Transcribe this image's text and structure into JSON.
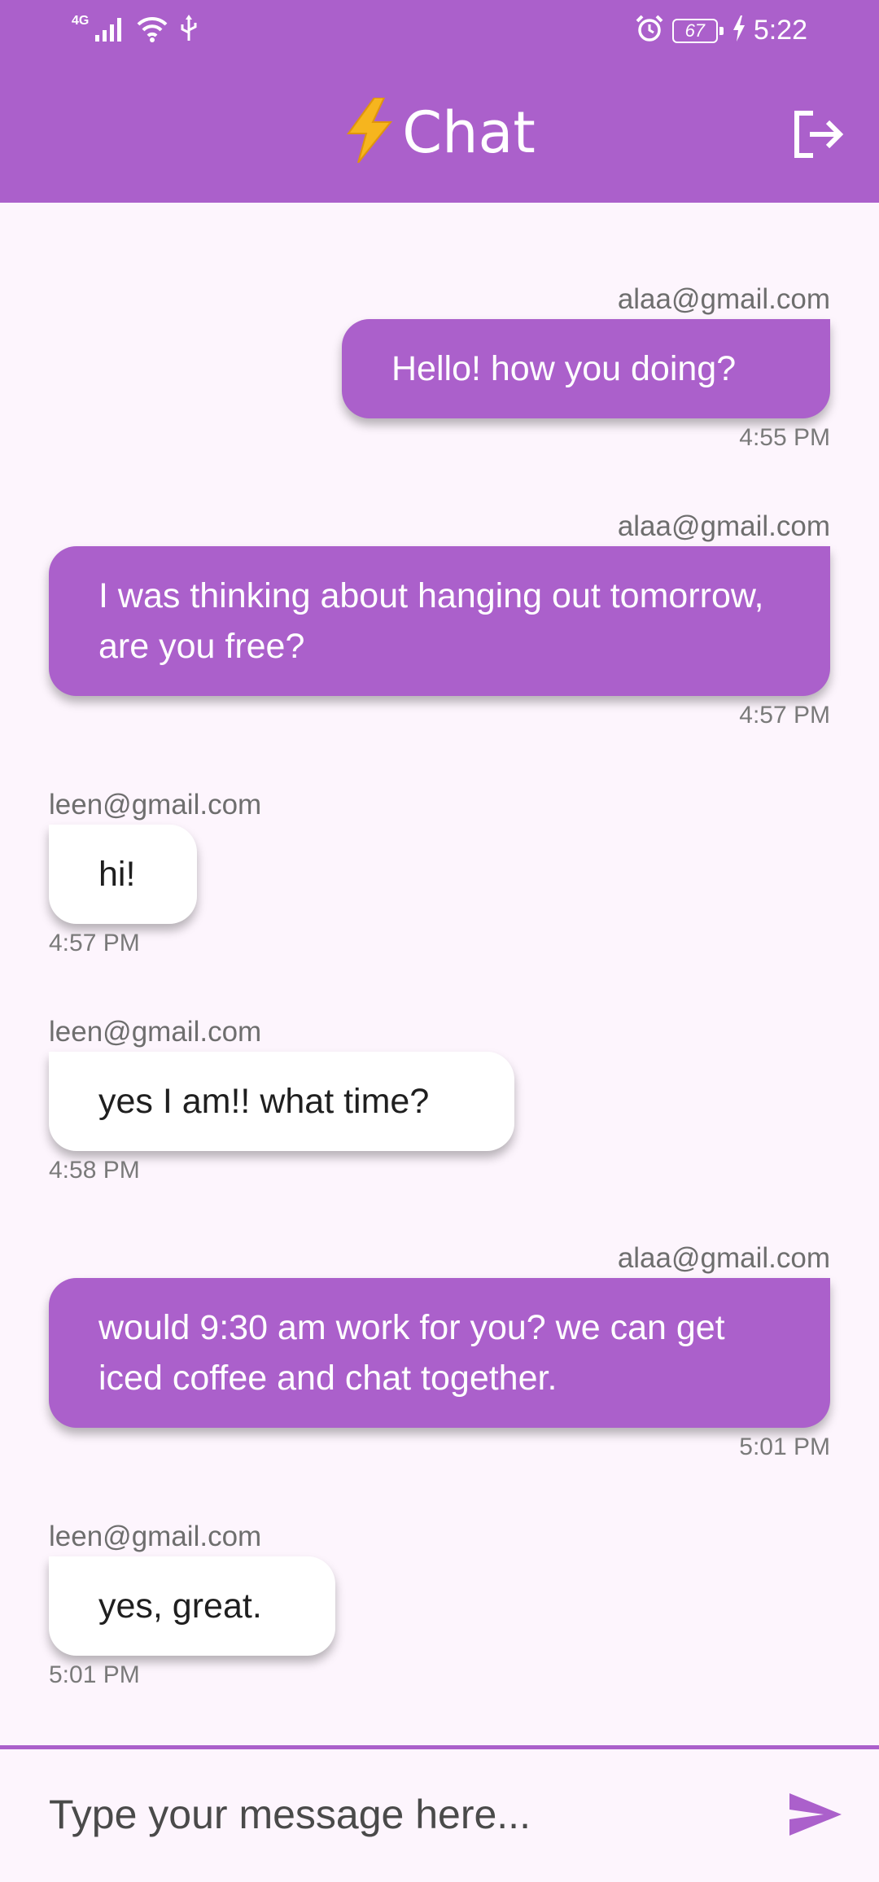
{
  "status_bar": {
    "network": "4G",
    "battery": "67",
    "time": "5:22"
  },
  "app_bar": {
    "title": "Chat",
    "title_emoji": "⚡",
    "accent_color": "#ab60cb"
  },
  "messages": [
    {
      "sender": "alaa@gmail.com",
      "text": "Hello! how you doing?",
      "time": "4:55 PM",
      "is_me": true
    },
    {
      "sender": "alaa@gmail.com",
      "text": "I was thinking about hanging out tomorrow, are you free?",
      "time": "4:57 PM",
      "is_me": true
    },
    {
      "sender": "leen@gmail.com",
      "text": "hi!",
      "time": "4:57 PM",
      "is_me": false
    },
    {
      "sender": "leen@gmail.com",
      "text": "yes I am!! what time?",
      "time": "4:58 PM",
      "is_me": false
    },
    {
      "sender": "alaa@gmail.com",
      "text": "would 9:30 am work for you? we can get iced coffee and chat together.",
      "time": "5:01 PM",
      "is_me": true
    },
    {
      "sender": "leen@gmail.com",
      "text": "yes, great.",
      "time": "5:01 PM",
      "is_me": false
    }
  ],
  "composer": {
    "placeholder": "Type your message here...",
    "value": ""
  },
  "icons": {
    "logout": "logout-icon",
    "send": "send-icon"
  }
}
